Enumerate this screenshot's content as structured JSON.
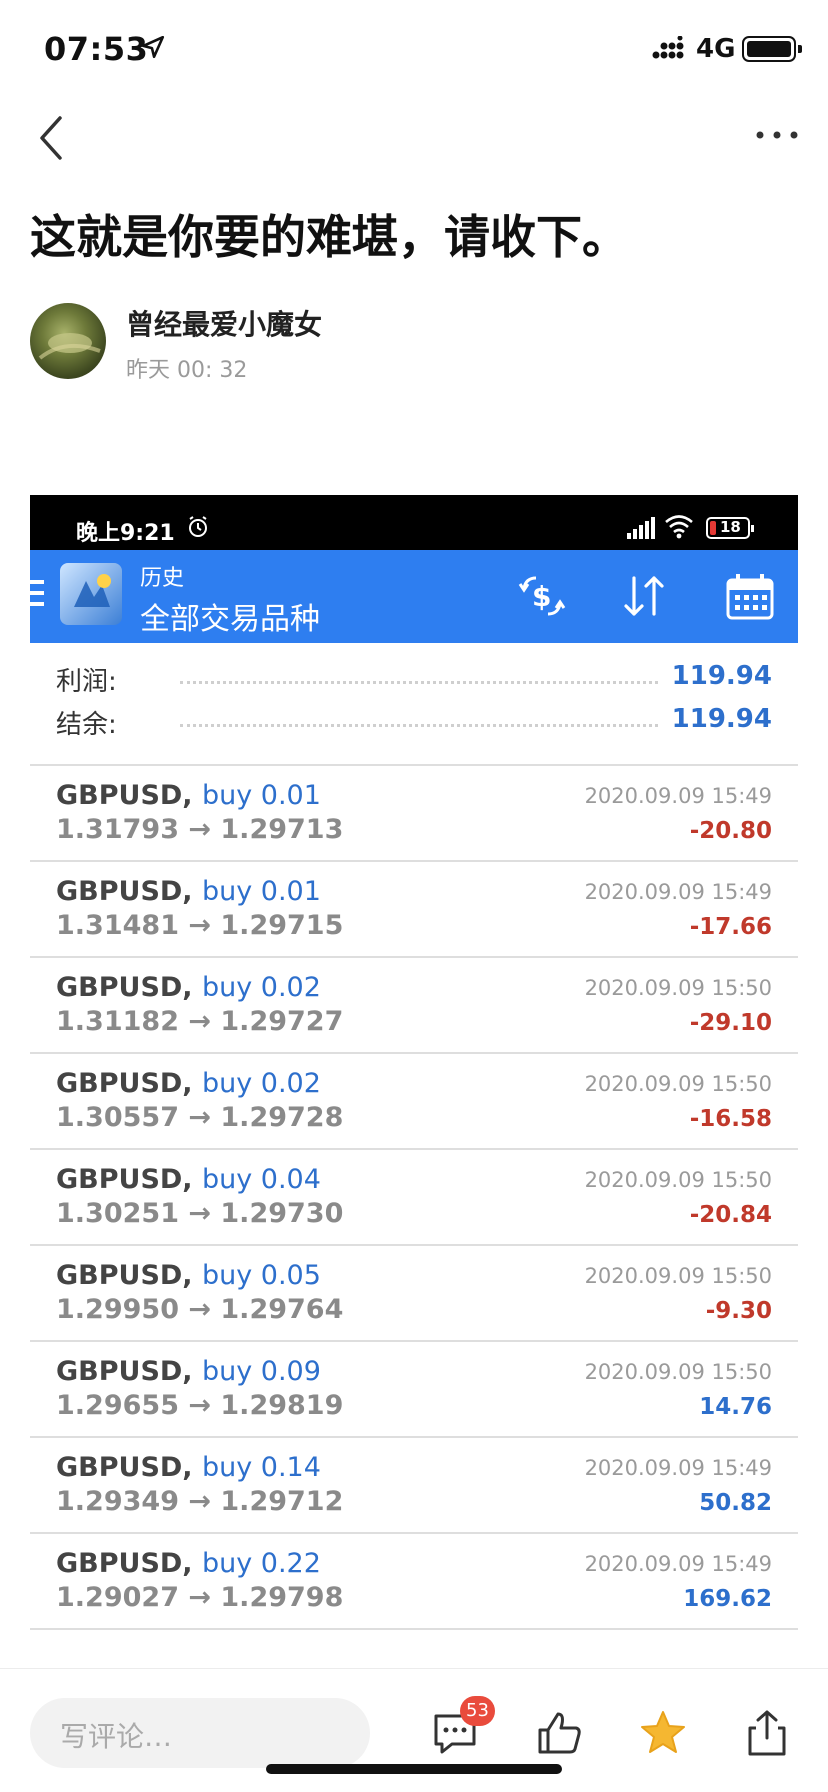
{
  "status_bar": {
    "time": "07:53",
    "network": "4G"
  },
  "article": {
    "title": "这就是你要的难堪，请收下。",
    "author": "曾经最爱小魔女",
    "post_time": "昨天 00: 32"
  },
  "screenshot": {
    "status_time": "晚上9:21",
    "battery_text": "18",
    "toolbar": {
      "title_small": "历史",
      "title_big": "全部交易品种"
    },
    "summary": [
      {
        "label": "利润:",
        "value": "119.94"
      },
      {
        "label": "结余:",
        "value": "119.94"
      }
    ],
    "deals": [
      {
        "symbol": "GBPUSD,",
        "type": "buy 0.01",
        "prices": "1.31793 → 1.29713",
        "time": "2020.09.09 15:49",
        "profit": "-20.80",
        "sign": "neg"
      },
      {
        "symbol": "GBPUSD,",
        "type": "buy 0.01",
        "prices": "1.31481 → 1.29715",
        "time": "2020.09.09 15:49",
        "profit": "-17.66",
        "sign": "neg"
      },
      {
        "symbol": "GBPUSD,",
        "type": "buy 0.02",
        "prices": "1.31182 → 1.29727",
        "time": "2020.09.09 15:50",
        "profit": "-29.10",
        "sign": "neg"
      },
      {
        "symbol": "GBPUSD,",
        "type": "buy 0.02",
        "prices": "1.30557 → 1.29728",
        "time": "2020.09.09 15:50",
        "profit": "-16.58",
        "sign": "neg"
      },
      {
        "symbol": "GBPUSD,",
        "type": "buy 0.04",
        "prices": "1.30251 → 1.29730",
        "time": "2020.09.09 15:50",
        "profit": "-20.84",
        "sign": "neg"
      },
      {
        "symbol": "GBPUSD,",
        "type": "buy 0.05",
        "prices": "1.29950 → 1.29764",
        "time": "2020.09.09 15:50",
        "profit": "-9.30",
        "sign": "neg"
      },
      {
        "symbol": "GBPUSD,",
        "type": "buy 0.09",
        "prices": "1.29655 → 1.29819",
        "time": "2020.09.09 15:50",
        "profit": "14.76",
        "sign": "pos"
      },
      {
        "symbol": "GBPUSD,",
        "type": "buy 0.14",
        "prices": "1.29349 → 1.29712",
        "time": "2020.09.09 15:49",
        "profit": "50.82",
        "sign": "pos"
      },
      {
        "symbol": "GBPUSD,",
        "type": "buy 0.22",
        "prices": "1.29027 → 1.29798",
        "time": "2020.09.09 15:49",
        "profit": "169.62",
        "sign": "pos"
      }
    ]
  },
  "bottom_bar": {
    "comment_placeholder": "写评论…",
    "comment_count": "53"
  },
  "colors": {
    "accent_blue": "#2e7ef0",
    "profit_negative": "#c0392b",
    "profit_positive": "#2d6fcc",
    "badge": "#e94b3c",
    "star": "#f5b731"
  },
  "icons": [
    "location-arrow-icon",
    "signal-icon",
    "battery-icon",
    "back-chevron-icon",
    "more-dots-icon",
    "alarm-icon",
    "wifi-icon",
    "menu-icon",
    "metatrader-logo-icon",
    "currency-exchange-icon",
    "sort-icon",
    "calendar-icon",
    "comment-icon",
    "like-icon",
    "star-icon",
    "share-icon"
  ]
}
